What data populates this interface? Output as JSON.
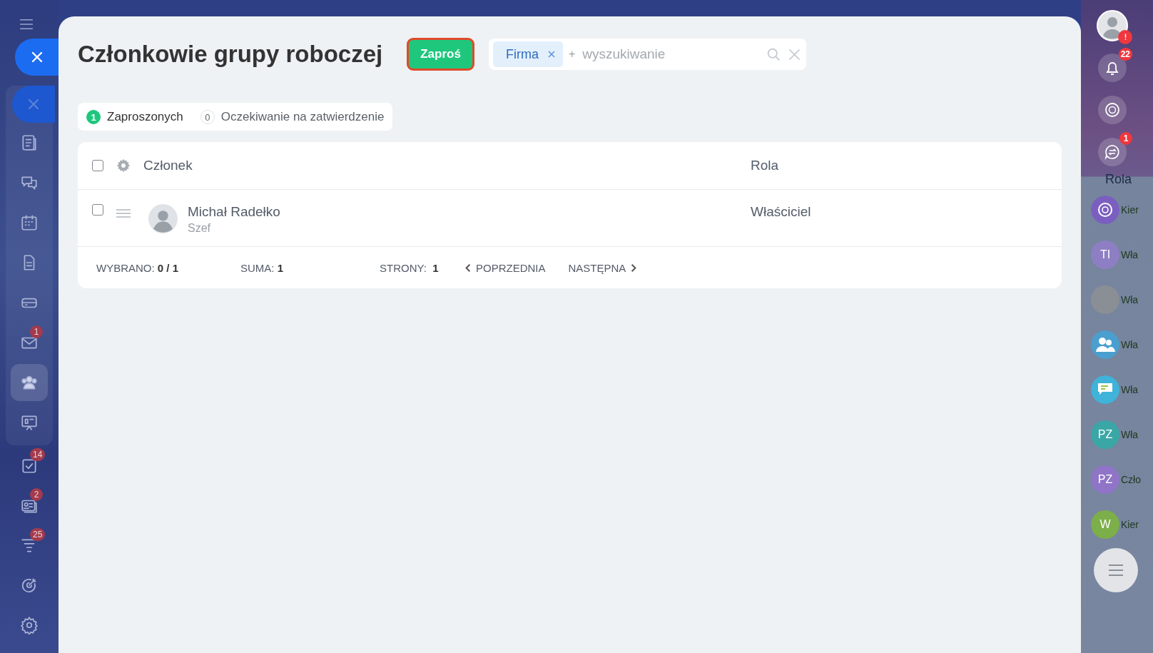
{
  "left_nav": {
    "items": [
      {
        "kind": "feed",
        "selected": false
      },
      {
        "kind": "chat",
        "selected": false
      },
      {
        "kind": "calendar",
        "selected": false
      },
      {
        "kind": "document",
        "selected": false
      },
      {
        "kind": "drive",
        "selected": false
      },
      {
        "kind": "mail",
        "selected": false,
        "badge": "1"
      },
      {
        "kind": "group",
        "selected": true
      },
      {
        "kind": "board",
        "selected": false
      },
      {
        "kind": "tasks",
        "selected": false,
        "badge": "14"
      },
      {
        "kind": "card",
        "selected": false,
        "badge": "2"
      },
      {
        "kind": "funnel",
        "selected": false,
        "badge": "25"
      },
      {
        "kind": "target",
        "selected": false
      },
      {
        "kind": "settings",
        "selected": false
      }
    ]
  },
  "modal": {
    "title": "Członkowie grupy roboczej",
    "invite_button": "Zaproś",
    "filter": {
      "chip": "Firma",
      "plus": "+",
      "placeholder": "wyszukiwanie"
    },
    "tabs": [
      {
        "count": "1",
        "label": "Zaproszonych",
        "selected": true
      },
      {
        "count": "0",
        "label": "Oczekiwanie na zatwierdzenie",
        "selected": false
      }
    ],
    "table": {
      "checked": false,
      "columns": [
        "Członek",
        "Rola"
      ],
      "rows": [
        {
          "name": "Michał Radełko",
          "position": "Szef",
          "role": "Właściciel",
          "checked": false
        }
      ],
      "footer": {
        "selected_label": "WYBRANO:",
        "selected_value": "0 / 1",
        "total_label": "SUMA:",
        "total_value": "1",
        "pages_label": "STRONY:",
        "pages_value": "1",
        "prev": "POPRZEDNIA",
        "next": "NASTĘPNA"
      }
    }
  },
  "right_panel": {
    "notifications_badge": "22",
    "chat_badge": "1",
    "column_heading": "Rola",
    "rows": [
      {
        "kind": "icon",
        "color": "#7b5fc0",
        "label": "Kier"
      },
      {
        "kind": "initials",
        "initials": "TI",
        "color": "#8e7fc4",
        "label": "Wła"
      },
      {
        "kind": "photo",
        "color": "#8a8f96",
        "label": "Wła"
      },
      {
        "kind": "group",
        "color": "#4a9fcf",
        "label": "Wła"
      },
      {
        "kind": "chat",
        "color": "#3fb3d9",
        "label": "Wła"
      },
      {
        "kind": "initials",
        "initials": "PZ",
        "color": "#3aa7a6",
        "label": "Wła"
      },
      {
        "kind": "initials",
        "initials": "PZ",
        "color": "#8f74c7",
        "label": "Czło"
      },
      {
        "kind": "initials",
        "initials": "W",
        "color": "#7cae4a",
        "label": "Kier"
      }
    ]
  }
}
